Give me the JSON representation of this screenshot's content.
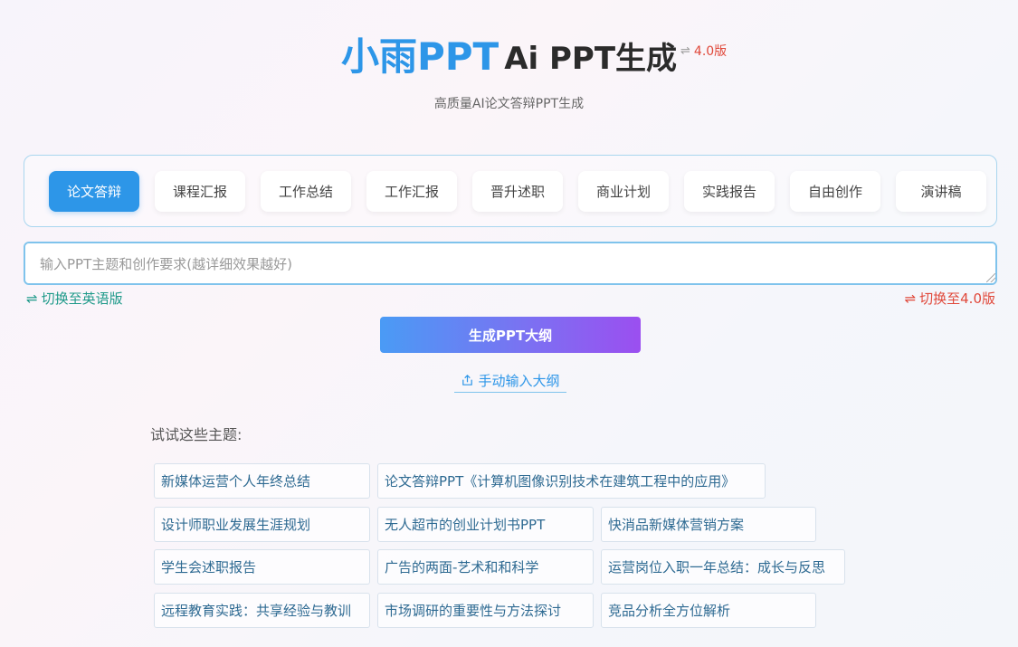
{
  "header": {
    "brand": "小雨PPT",
    "title_rest": "Ai PPT生成",
    "version_tag": "4.0版",
    "subtitle": "高质量AI论文答辩PPT生成"
  },
  "tabs": [
    {
      "label": "论文答辩",
      "active": true
    },
    {
      "label": "课程汇报",
      "active": false
    },
    {
      "label": "工作总结",
      "active": false
    },
    {
      "label": "工作汇报",
      "active": false
    },
    {
      "label": "晋升述职",
      "active": false
    },
    {
      "label": "商业计划",
      "active": false
    },
    {
      "label": "实践报告",
      "active": false
    },
    {
      "label": "自由创作",
      "active": false
    },
    {
      "label": "演讲稿",
      "active": false
    }
  ],
  "input": {
    "placeholder": "输入PPT主题和创作要求(越详细效果越好)",
    "value": ""
  },
  "switch_lang_label": "切换至英语版",
  "switch_version_label": "切换至4.0版",
  "generate_button_label": "生成PPT大纲",
  "manual_outline_label": "手动输入大纲",
  "try_label": "试试这些主题:",
  "suggestions": [
    "新媒体运营个人年终总结",
    "论文答辩PPT《计算机图像识别技术在建筑工程中的应用》",
    "设计师职业发展生涯规划",
    "无人超市的创业计划书PPT",
    "快消品新媒体营销方案",
    "学生会述职报告",
    "广告的两面-艺术和和科学",
    "运营岗位入职一年总结：成长与反思",
    "远程教育实践：共享经验与教训",
    "市场调研的重要性与方法探讨",
    "竞品分析全方位解析"
  ],
  "colors": {
    "brand_blue": "#2d96e8",
    "version_red": "#e0483a",
    "switch_green": "#1f9a8a"
  }
}
